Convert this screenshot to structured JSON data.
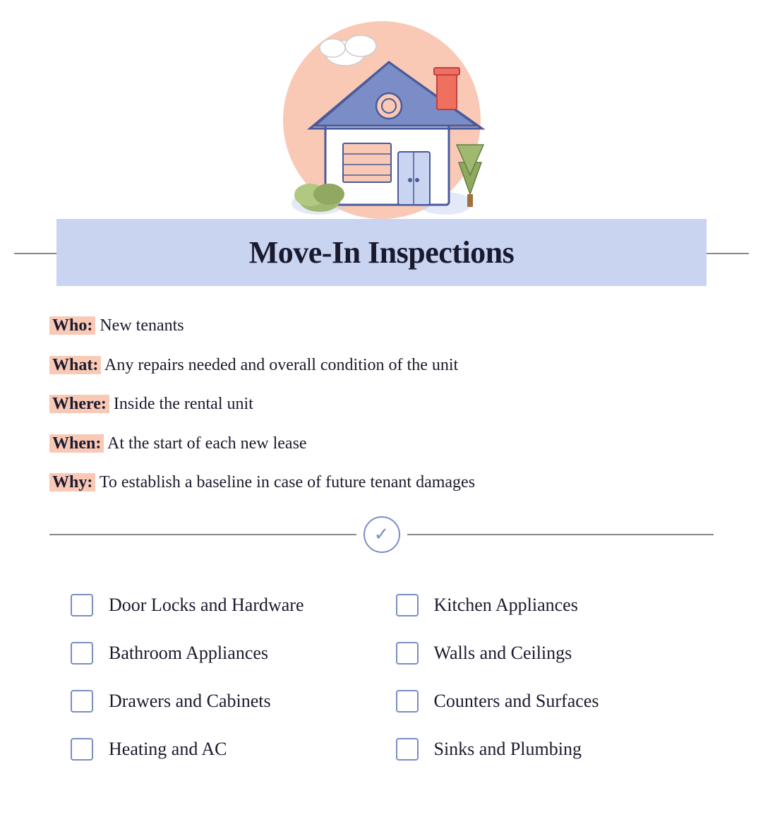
{
  "title": "Move-In Inspections",
  "info": [
    {
      "id": "who",
      "label": "Who:",
      "text": " New tenants",
      "highlight": true
    },
    {
      "id": "what",
      "label": "What:",
      "text": " Any repairs needed and overall condition of the unit",
      "highlight": true
    },
    {
      "id": "where",
      "label": "Where:",
      "text": " Inside the rental unit",
      "highlight": true
    },
    {
      "id": "when",
      "label": "When:",
      "text": " At the start of each new lease",
      "highlight": true
    },
    {
      "id": "why",
      "label": "Why:",
      "text": " To establish a baseline in case of future tenant damages",
      "highlight": true
    }
  ],
  "checklist": [
    {
      "id": "door-locks",
      "label": "Door Locks and Hardware"
    },
    {
      "id": "kitchen-appliances",
      "label": "Kitchen Appliances"
    },
    {
      "id": "bathroom-appliances",
      "label": "Bathroom Appliances"
    },
    {
      "id": "walls-ceilings",
      "label": "Walls and Ceilings"
    },
    {
      "id": "drawers-cabinets",
      "label": "Drawers and Cabinets"
    },
    {
      "id": "counters-surfaces",
      "label": "Counters and Surfaces"
    },
    {
      "id": "heating-ac",
      "label": "Heating and AC"
    },
    {
      "id": "sinks-plumbing",
      "label": "Sinks and Plumbing"
    }
  ],
  "colors": {
    "accent_pink": "#f9c9b6",
    "accent_blue": "#c8d4f0",
    "border_blue": "#7a8dc7",
    "dark": "#1a1a2e"
  }
}
